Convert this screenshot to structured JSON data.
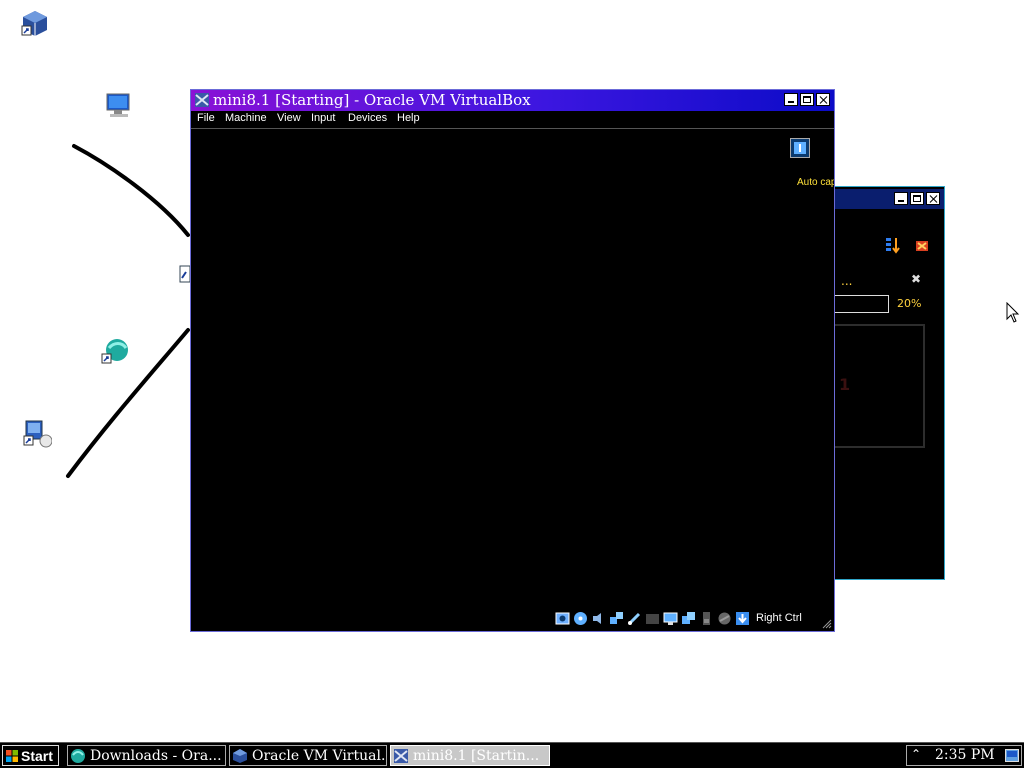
{
  "vm_window": {
    "title": "mini8.1 [Starting] - Oracle VM VirtualBox",
    "menu": [
      "File",
      "Machine",
      "View",
      "Input",
      "Devices",
      "Help"
    ],
    "auto_capture_text": "Auto capture",
    "host_key": "Right Ctrl",
    "status_icons": [
      "hard-disk-icon",
      "optical-drive-icon",
      "audio-icon",
      "network-icon",
      "usb-icon",
      "shared-folders-icon",
      "display-icon",
      "video-capture-icon",
      "virtualization-icon",
      "mouse-integration-icon",
      "arrow-down-icon"
    ]
  },
  "background_window": {
    "progress_dots": "...",
    "progress_percent": "20%",
    "progress_value": 0.2,
    "vm_label_fragment": "1"
  },
  "taskbar": {
    "start_label": "Start",
    "tasks": [
      {
        "label": "Downloads - Ora...",
        "active": false
      },
      {
        "label": "Oracle VM Virtual...",
        "active": false
      },
      {
        "label": "mini8.1 [Startin...",
        "active": true
      }
    ],
    "clock": "2:35 PM"
  },
  "colors": {
    "title_gradient_start": "#8a12d6",
    "title_gradient_end": "#0b0bc7",
    "autocap_yellow": "#ffe13a",
    "accent_cyan": "#2fa6c9"
  }
}
